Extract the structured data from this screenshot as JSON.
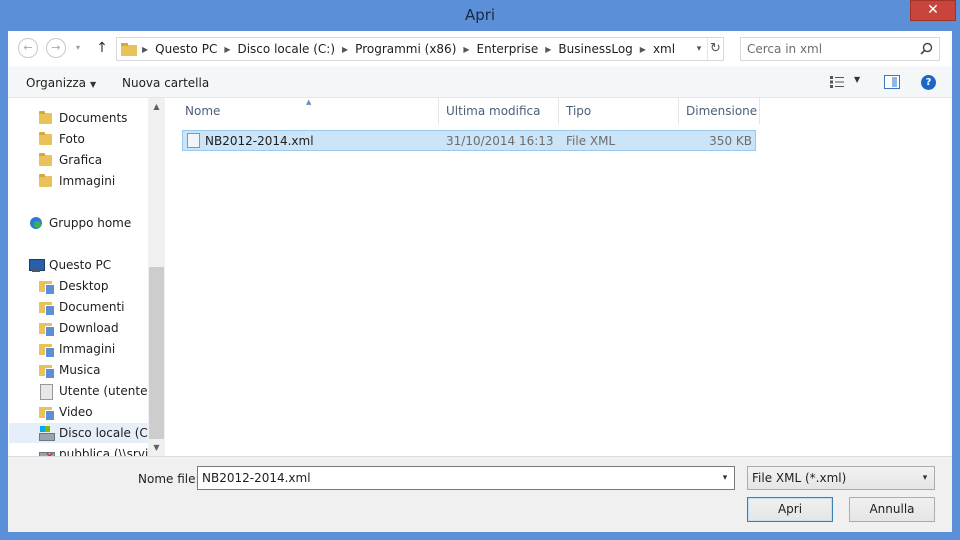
{
  "window": {
    "title": "Apri",
    "close_glyph": "✕"
  },
  "nav": {
    "back_glyph": "←",
    "forward_glyph": "→",
    "recent_glyph": "▾",
    "up_glyph": "↑"
  },
  "address": {
    "crumbs": [
      "Questo PC",
      "Disco locale (C:)",
      "Programmi (x86)",
      "Enterprise",
      "BusinessLog",
      "xml"
    ],
    "separator_glyph": "▶",
    "dropdown_glyph": "▾",
    "refresh_glyph": "↻"
  },
  "search": {
    "placeholder": "Cerca in xml"
  },
  "toolbar": {
    "organize_label": "Organizza",
    "organize_caret": "▼",
    "new_folder_label": "Nuova cartella",
    "view_caret": "▼",
    "help_glyph": "?"
  },
  "sidebar": {
    "items": [
      {
        "label": "Documents",
        "icon": "folder-icon"
      },
      {
        "label": "Foto",
        "icon": "folder-icon"
      },
      {
        "label": "Grafica",
        "icon": "folder-icon"
      },
      {
        "label": "Immagini",
        "icon": "folder-icon"
      },
      {
        "label": "Gruppo home",
        "icon": "homegroup-icon"
      },
      {
        "label": "Questo PC",
        "icon": "computer-icon"
      },
      {
        "label": "Desktop",
        "icon": "library-icon"
      },
      {
        "label": "Documenti",
        "icon": "library-icon"
      },
      {
        "label": "Download",
        "icon": "library-icon"
      },
      {
        "label": "Immagini",
        "icon": "library-icon"
      },
      {
        "label": "Musica",
        "icon": "library-icon"
      },
      {
        "label": "Utente (utente-p",
        "icon": "user-folder-icon"
      },
      {
        "label": "Video",
        "icon": "library-icon"
      },
      {
        "label": "Disco locale (C:)",
        "icon": "local-disk-icon",
        "selected": true
      },
      {
        "label": "pubblica (\\\\srvitr",
        "icon": "network-drive-icon"
      }
    ],
    "scroll_up_glyph": "▲",
    "scroll_down_glyph": "▼"
  },
  "filelist": {
    "columns": [
      "Nome",
      "Ultima modifica",
      "Tipo",
      "Dimensione"
    ],
    "sort_glyph": "▲",
    "rows": [
      {
        "name": "NB2012-2014.xml",
        "modified": "31/10/2014 16:13",
        "type": "File XML",
        "size": "350 KB"
      }
    ]
  },
  "footer": {
    "filename_label": "Nome file:",
    "filename_value": "NB2012-2014.xml",
    "dropdown_glyph": "▾",
    "filter_value": "File XML (*.xml)",
    "open_label": "Apri",
    "cancel_label": "Annulla"
  },
  "colors": {
    "accent": "#5b8fd8",
    "selection": "#cce4f7",
    "close": "#c7453b"
  }
}
